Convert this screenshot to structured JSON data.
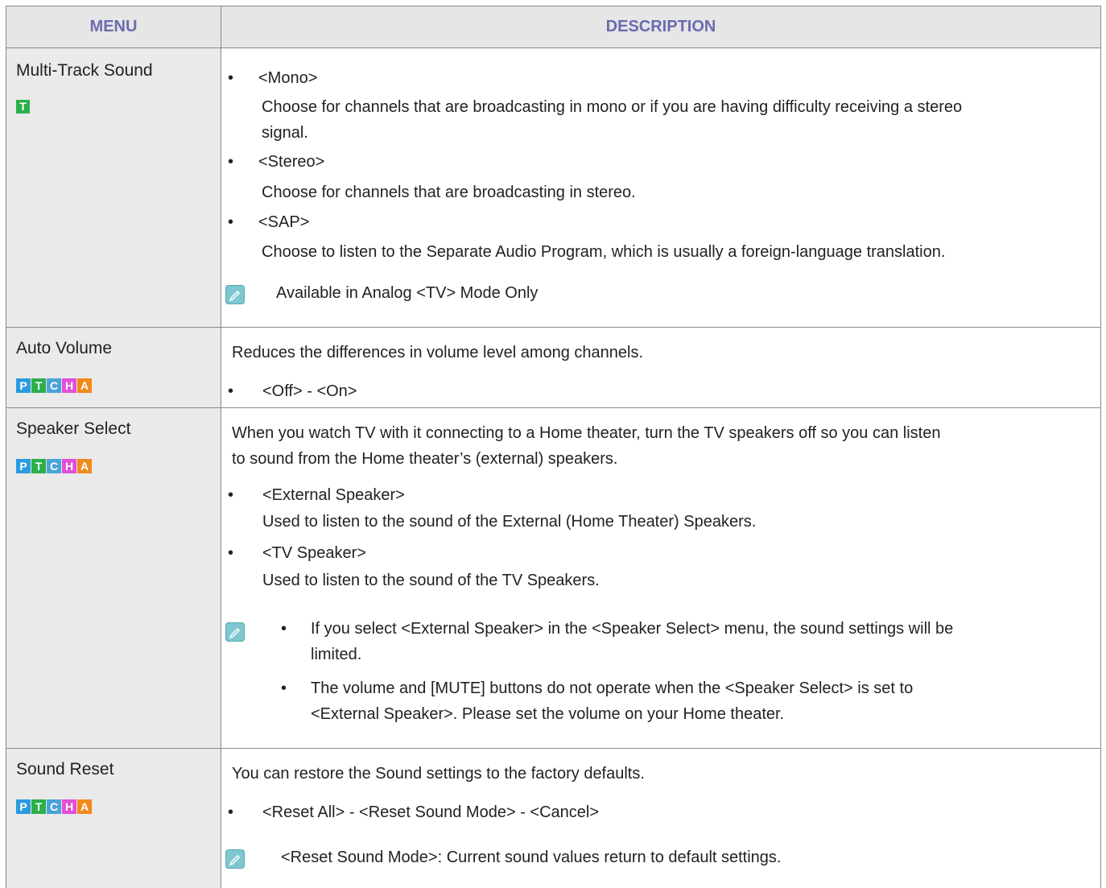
{
  "header": {
    "menu": "MENU",
    "description": "DESCRIPTION"
  },
  "mode_icons": {
    "letters": [
      "P",
      "T",
      "C",
      "H",
      "A"
    ],
    "colors": [
      "#2a9be0",
      "#2bb04a",
      "#4aa3d8",
      "#e24fd8",
      "#f08a1c"
    ]
  },
  "rows": [
    {
      "menu": "Multi-Track Sound",
      "icon": "T",
      "items": [
        {
          "title": "<Mono>",
          "desc_line1": "Choose for channels that are broadcasting in mono or if you are having difficulty receiving a stereo",
          "desc_line2": "signal."
        },
        {
          "title": "<Stereo>",
          "desc": "Choose for channels that are broadcasting in stereo."
        },
        {
          "title": "<SAP>",
          "desc": "Choose to listen to the Separate Audio Program, which is usually a foreign-language translation."
        }
      ],
      "note": "Available in Analog <TV> Mode Only"
    },
    {
      "menu": "Auto Volume",
      "intro": "Reduces the differences in volume level among channels.",
      "items": [
        {
          "title": "<Off> - <On>"
        }
      ]
    },
    {
      "menu": "Speaker Select",
      "intro_line1": "When you watch TV with it connecting to a Home theater, turn the TV speakers off so you can listen",
      "intro_line2": "to sound from the Home theater’s (external) speakers.",
      "items": [
        {
          "title": "<External Speaker>",
          "desc": "Used to listen to the sound of the External (Home Theater) Speakers."
        },
        {
          "title": "<TV Speaker>",
          "desc": "Used to listen to the sound of the TV Speakers."
        }
      ],
      "notes": [
        {
          "line1": "If you select <External Speaker> in the <Speaker Select> menu, the sound settings will be",
          "line2": "limited."
        },
        {
          "line1": "The volume and [MUTE] buttons do not operate when the <Speaker Select> is set to",
          "line2": "<External Speaker>. Please set the volume on your Home theater."
        }
      ]
    },
    {
      "menu": "Sound Reset",
      "intro": "You can restore the Sound settings to the factory defaults.",
      "items": [
        {
          "title": "<Reset All> - <Reset Sound Mode> - <Cancel>"
        }
      ],
      "note": "<Reset Sound Mode>: Current sound values return to default settings."
    }
  ]
}
